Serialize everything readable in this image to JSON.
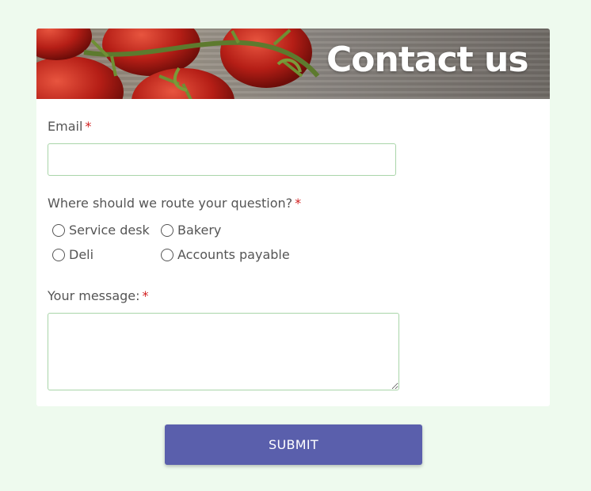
{
  "banner": {
    "title": "Contact us"
  },
  "form": {
    "email": {
      "label": "Email",
      "required_mark": "*",
      "value": ""
    },
    "route": {
      "label": "Where should we route your question?",
      "required_mark": "*",
      "options": [
        "Service desk",
        "Bakery",
        "Deli",
        "Accounts payable"
      ]
    },
    "message": {
      "label": "Your message:",
      "required_mark": "*",
      "value": ""
    },
    "submit_label": "SUBMIT"
  },
  "colors": {
    "background": "#eefaee",
    "submit": "#5a5fac",
    "required": "#d21f1f",
    "input_border": "#a9d5a9"
  }
}
